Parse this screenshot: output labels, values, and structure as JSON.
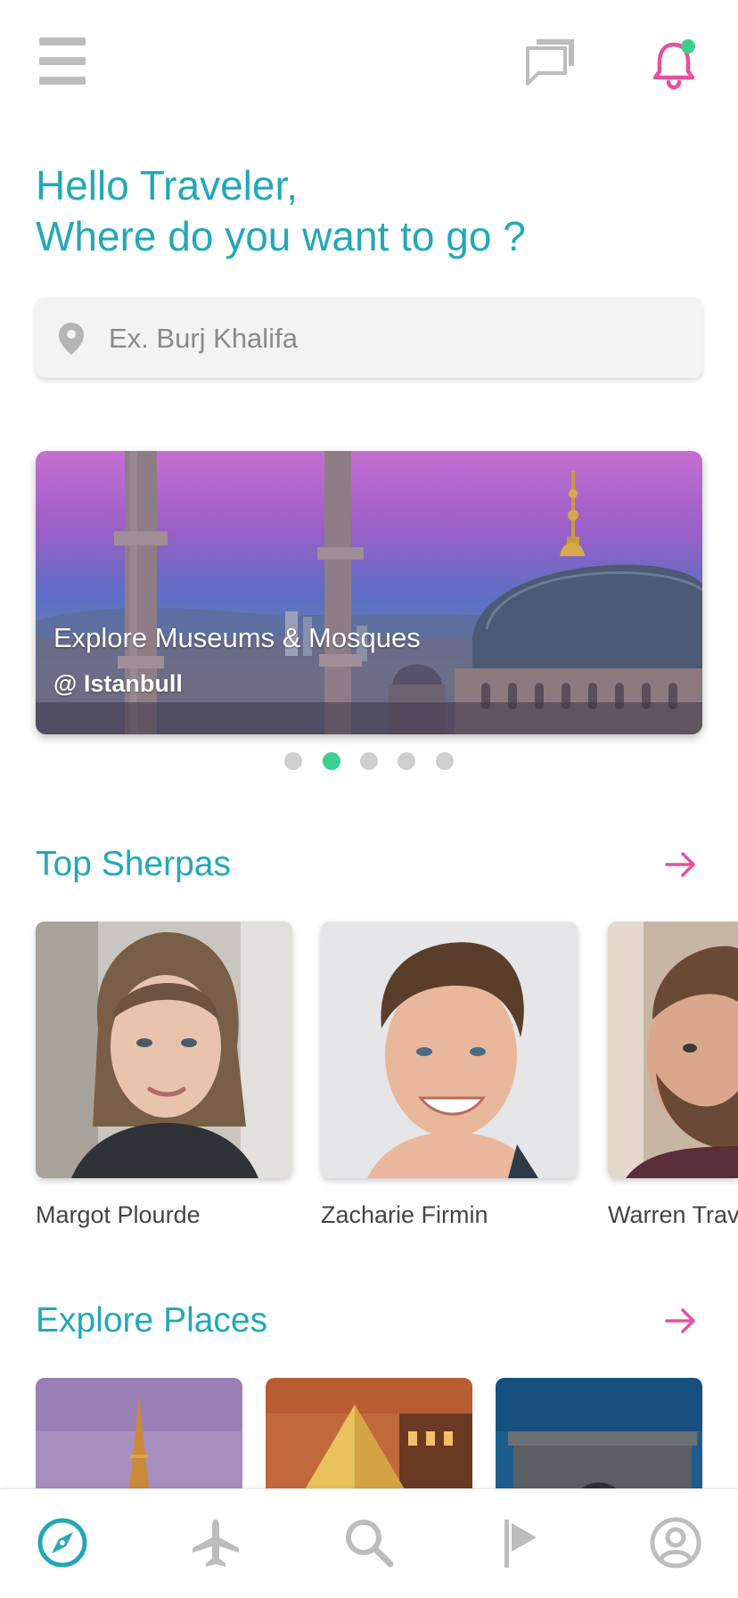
{
  "header": {
    "greeting_line1": "Hello Traveler,",
    "greeting_line2": "Where do you want to go ?"
  },
  "search": {
    "placeholder": "Ex. Burj Khalifa"
  },
  "hero": {
    "title": "Explore Museums & Mosques",
    "subtitle": "@ Istanbull",
    "page_count": 5,
    "active_page": 2
  },
  "top_sherpas": {
    "title": "Top Sherpas",
    "people": [
      {
        "name": "Margot Plourde"
      },
      {
        "name": "Zacharie Firmin"
      },
      {
        "name": "Warren Trav"
      }
    ]
  },
  "explore_places": {
    "title": "Explore Places"
  },
  "colors": {
    "accent": "#22a8b8",
    "pink": "#ea4f9c",
    "active_dot": "#3ccf8e",
    "icon_gray": "#bdbdbd"
  },
  "icons": {
    "menu": "menu-icon",
    "chat": "chat-icon",
    "bell": "bell-icon",
    "pin": "location-pin-icon",
    "arrow": "arrow-right-icon",
    "nav": [
      "compass-icon",
      "airplane-icon",
      "search-icon",
      "flag-icon",
      "profile-icon"
    ]
  }
}
